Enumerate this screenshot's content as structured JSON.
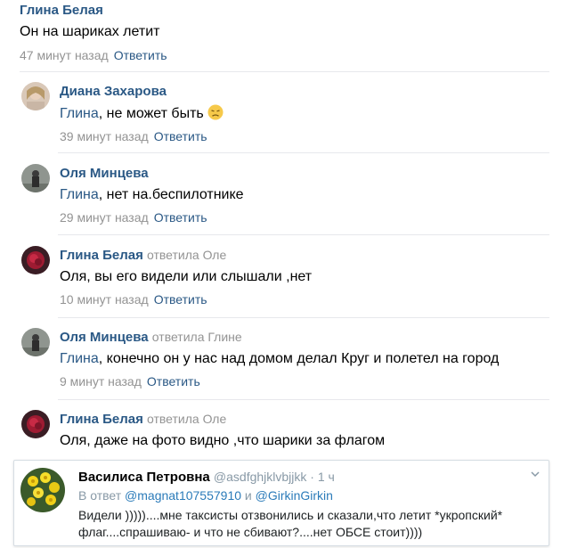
{
  "comments": [
    {
      "author": "Глина Белая",
      "reply_to": "",
      "addressee": "",
      "text": "Он на шариках летит",
      "time": "47 минут назад",
      "action": "Ответить"
    },
    {
      "author": "Диана Захарова",
      "reply_to": "",
      "addressee": "Глина",
      "text": ", не может быть",
      "time": "39 минут назад",
      "action": "Ответить",
      "emoji": "disappointed-face"
    },
    {
      "author": "Оля Минцева",
      "reply_to": "",
      "addressee": "Глина",
      "text": ", нет на.беспилотнике",
      "time": "29 минут назад",
      "action": "Ответить"
    },
    {
      "author": "Глина Белая",
      "reply_to": "ответила Оле",
      "addressee": "",
      "text": "Оля, вы его видели или слышали ,нет",
      "time": "10 минут назад",
      "action": "Ответить"
    },
    {
      "author": "Оля Минцева",
      "reply_to": "ответила Глине",
      "addressee": "Глина",
      "text": ", конечно он у нас над домом делал Круг и полетел на город",
      "time": "9 минут назад",
      "action": "Ответить"
    },
    {
      "author": "Глина Белая",
      "reply_to": "ответила Оле",
      "addressee": "",
      "text": "Оля, даже на фото видно ,что шарики за флагом",
      "time": "",
      "action": ""
    }
  ],
  "tweet": {
    "name": "Василиса Петровна",
    "handle": "@asdfghjklvbjjkk · 1 ч",
    "reply_prefix": "В ответ",
    "mention1": "@magnat107557910",
    "and": "и",
    "mention2": "@GirkinGirkin",
    "line1": "Видели )))))....мне таксисты отзвонились и сказали,что летит *укропский*",
    "line2": "флаг....спрашиваю- и что не сбивают?....нет ОБСЕ стоит))))"
  },
  "colors": {
    "vk_link": "#2a5885",
    "vk_meta": "#939393",
    "tw_link": "#2b7bb9",
    "tw_meta": "#8899a6"
  }
}
